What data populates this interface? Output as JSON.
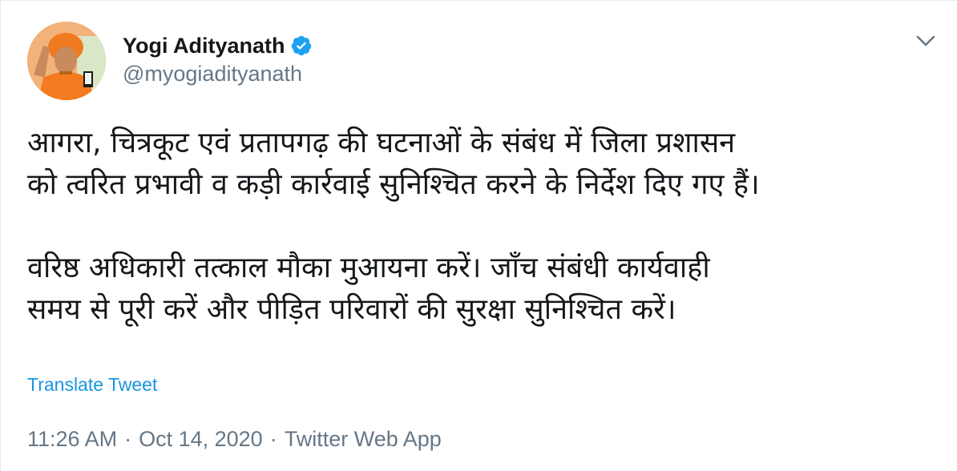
{
  "author": {
    "display_name": "Yogi Adityanath",
    "handle": "@myogiadityanath",
    "verified": true,
    "avatar_icon": "profile-photo"
  },
  "tweet": {
    "lines": [
      "आगरा, चित्रकूट एवं प्रतापगढ़ की घटनाओं के संबंध में जिला प्रशासन",
      "को त्वरित प्रभावी व कड़ी कार्रवाई सुनिश्चित करने के निर्देश दिए गए हैं।",
      "",
      "वरिष्ठ अधिकारी तत्काल मौका मुआयना करें। जाँच संबंधी कार्यवाही",
      "समय से पूरी करें और पीड़ित परिवारों की सुरक्षा सुनिश्चित करें।"
    ]
  },
  "actions": {
    "translate_label": "Translate Tweet",
    "menu_icon": "chevron-down-icon"
  },
  "meta": {
    "time": "11:26 AM",
    "date": "Oct 14, 2020",
    "source": "Twitter Web App",
    "separator": "·"
  },
  "colors": {
    "text": "#14171a",
    "secondary": "#657786",
    "link": "#1b95e0",
    "verified": "#1da1f2"
  }
}
